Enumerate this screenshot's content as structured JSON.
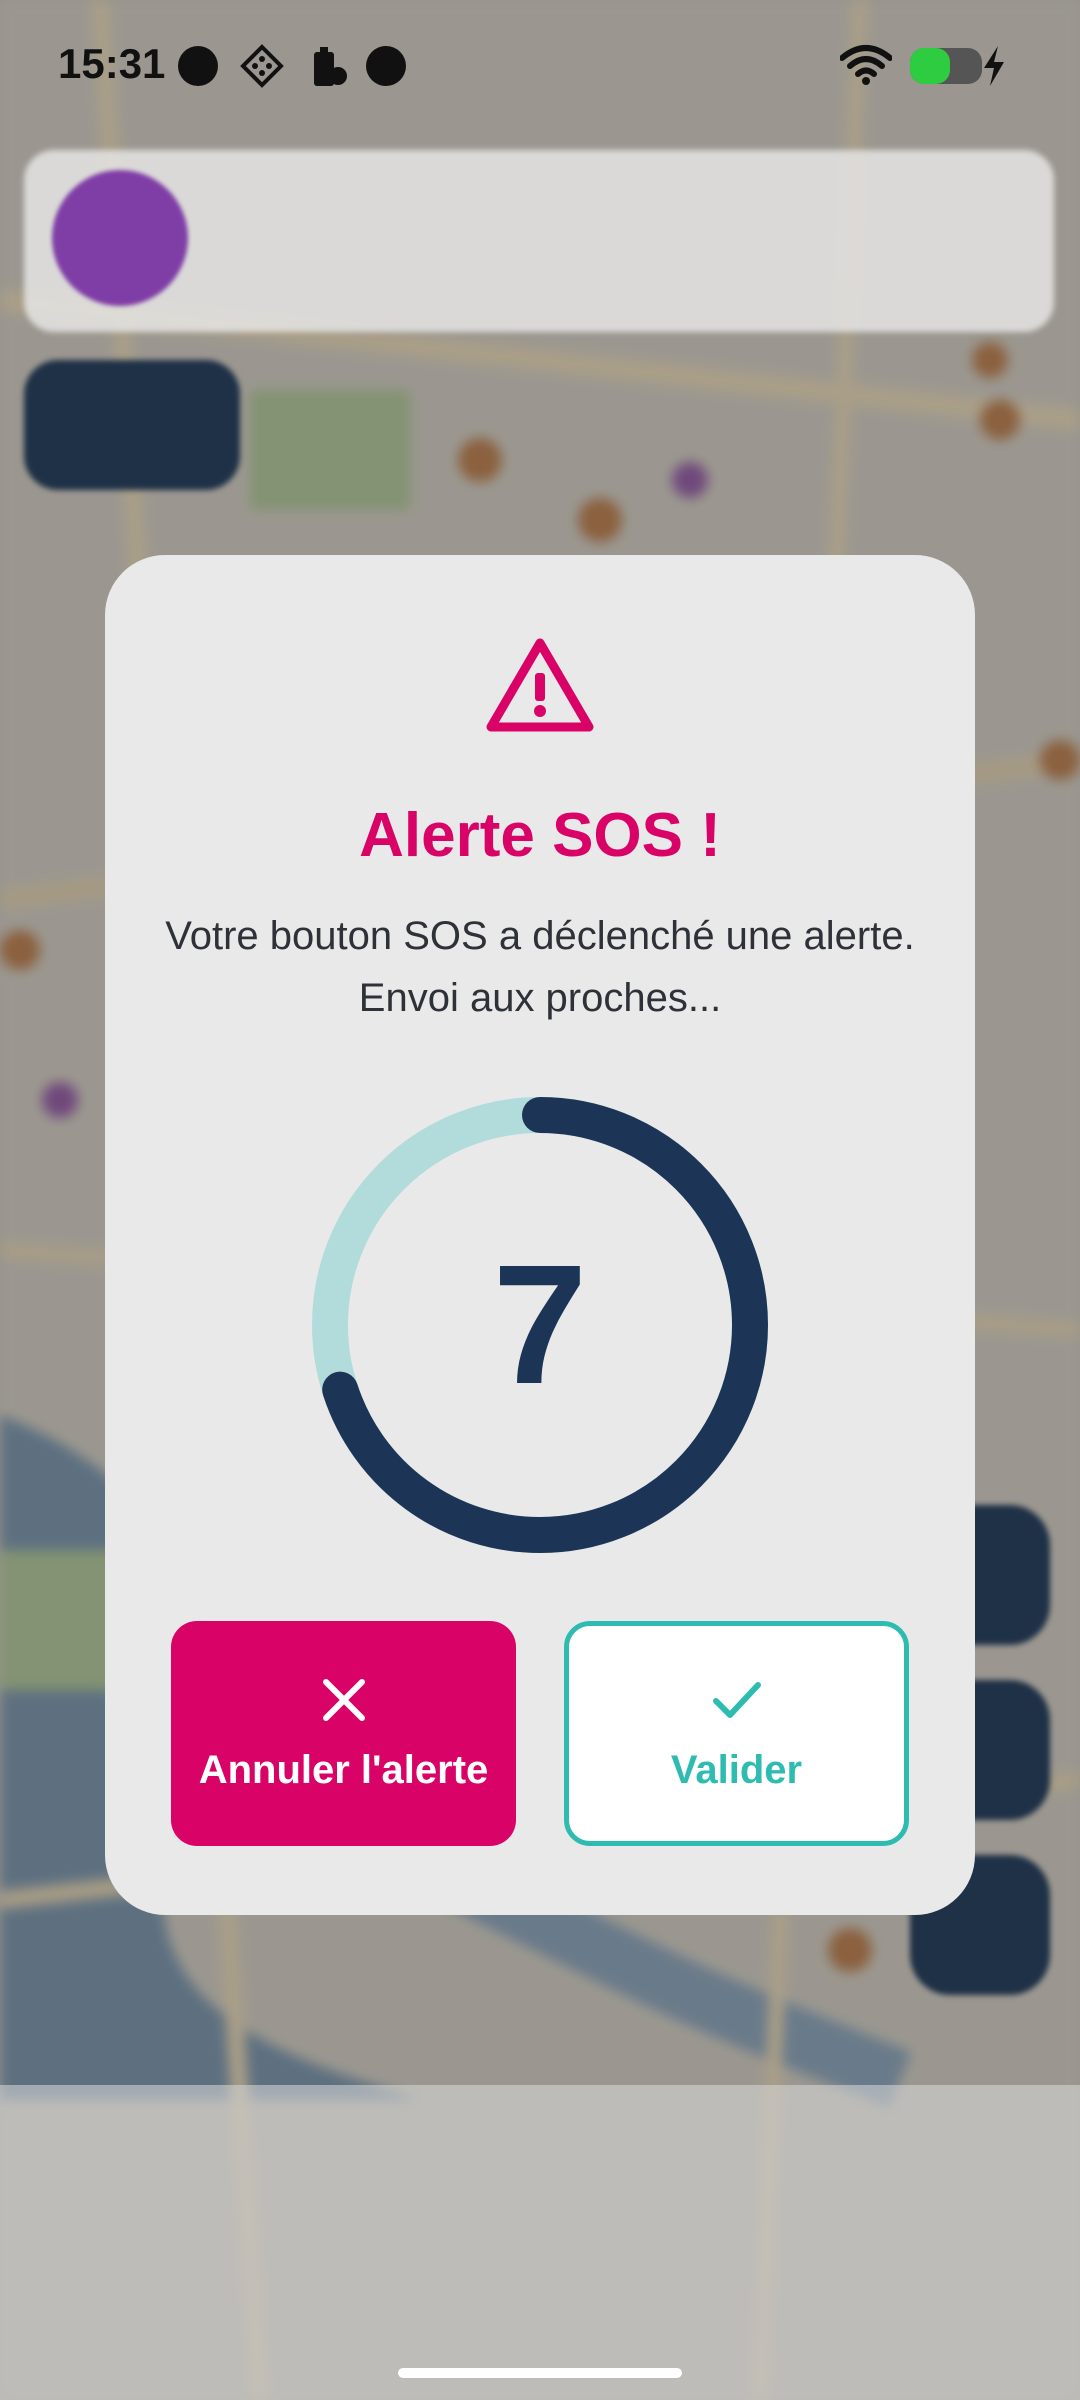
{
  "status_bar": {
    "time": "15:31",
    "left_icons": [
      "notification-dot-icon",
      "app-grid-icon",
      "battery-saver-icon",
      "notification-dot-icon"
    ],
    "right_icons": [
      "wifi-icon",
      "battery-icon",
      "charging-bolt-icon"
    ],
    "battery_color": "#2ecc40"
  },
  "dialog": {
    "icon": "warning-triangle-icon",
    "title": "Alerte SOS !",
    "message": "Votre bouton SOS a déclenché une alerte. Envoi aux proches...",
    "countdown": {
      "value": "7",
      "progress_fraction": 0.7
    },
    "buttons": {
      "cancel": {
        "label": "Annuler l'alerte",
        "icon": "close-icon"
      },
      "confirm": {
        "label": "Valider",
        "icon": "check-icon"
      }
    }
  },
  "colors": {
    "accent": "#d90368",
    "teal": "#2fbcb0",
    "navy": "#1c3557",
    "track": "#b2dcdb",
    "dialog_bg": "#e9e9ea"
  }
}
